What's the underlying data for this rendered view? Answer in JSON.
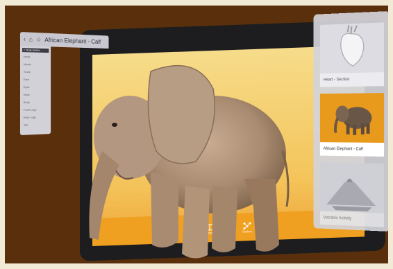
{
  "header": {
    "back_icon": "chevron-left-icon",
    "home_icon": "home-icon",
    "star_icon": "star-icon",
    "title": "African Elephant - Calf"
  },
  "menu": {
    "selected": "Body Section",
    "items": [
      "Head",
      "Mouth",
      "Trunk",
      "Ears",
      "Eyes",
      "Neck",
      "Body",
      "Front Legs",
      "Rear Legs",
      "Tail"
    ]
  },
  "cards": [
    {
      "label": "Heart - Section"
    },
    {
      "label": "African Elephant - Calf"
    },
    {
      "label": "Volcanic Activity"
    }
  ],
  "bottom_bar": {
    "book_label": "Learn",
    "network_label": "Explore"
  },
  "colors": {
    "background": "#5a300c",
    "accent": "#f0a020",
    "panel": "#d2d2da"
  }
}
